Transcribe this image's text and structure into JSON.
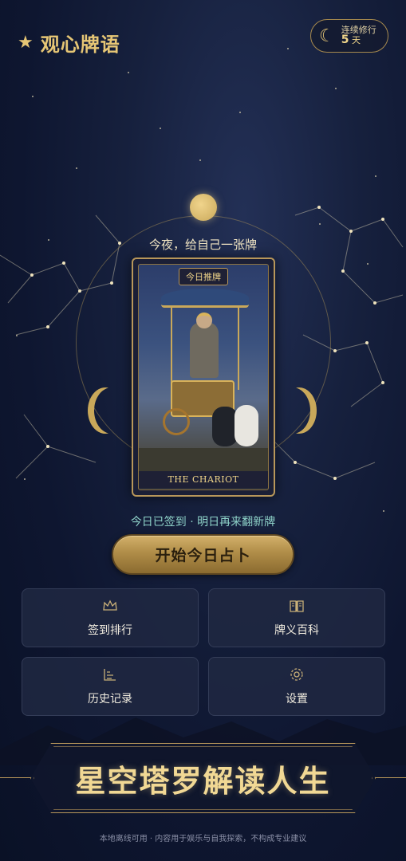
{
  "app": {
    "title": "观心牌语",
    "star": "★"
  },
  "streak": {
    "label": "连续修行",
    "value": "5",
    "unit": "天"
  },
  "subtitle": "今夜，给自己一张牌",
  "card": {
    "tag": "今日推牌",
    "name": "THE CHARIOT"
  },
  "status": "今日已签到 · 明日再来翻新牌",
  "cta": {
    "label": "开始今日占卜"
  },
  "menu": [
    {
      "label": "签到排行",
      "icon": "crown-icon"
    },
    {
      "label": "牌义百科",
      "icon": "book-icon"
    },
    {
      "label": "历史记录",
      "icon": "history-icon"
    },
    {
      "label": "设置",
      "icon": "gear-icon"
    }
  ],
  "banner": {
    "title": "星空塔罗解读人生"
  },
  "footer": "本地离线可用 · 内容用于娱乐与自我探索，不构成专业建议",
  "colors": {
    "accent": "#e6c675",
    "status": "#8fd3c9",
    "background": "#121a34"
  }
}
